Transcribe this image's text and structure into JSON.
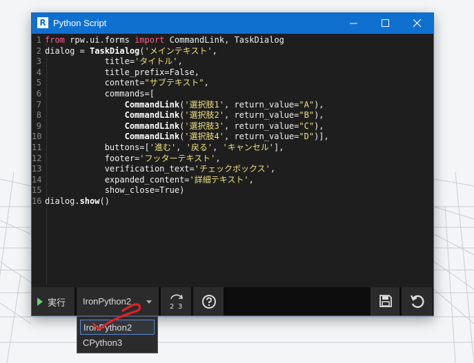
{
  "window": {
    "title": "Python Script",
    "app_icon": "R"
  },
  "editor": {
    "lines": [
      {
        "num": "1",
        "segs": [
          [
            "kw",
            "from"
          ],
          [
            "t",
            " rpw.ui.forms "
          ],
          [
            "kw",
            "import"
          ],
          [
            "t",
            " CommandLink, TaskDialog"
          ]
        ]
      },
      {
        "num": "2",
        "segs": [
          [
            "t",
            "dialog = "
          ],
          [
            "fn",
            "TaskDialog"
          ],
          [
            "t",
            "("
          ],
          [
            "st",
            "'メインテキスト'"
          ],
          [
            "t",
            ","
          ]
        ]
      },
      {
        "num": "3",
        "segs": [
          [
            "t",
            "            title="
          ],
          [
            "st",
            "'タイトル'"
          ],
          [
            "t",
            ","
          ]
        ]
      },
      {
        "num": "4",
        "segs": [
          [
            "t",
            "            title_prefix=False,"
          ]
        ]
      },
      {
        "num": "5",
        "segs": [
          [
            "t",
            "            content="
          ],
          [
            "st",
            "\"サブテキスト\""
          ],
          [
            "t",
            ","
          ]
        ]
      },
      {
        "num": "6",
        "segs": [
          [
            "t",
            "            commands=["
          ]
        ]
      },
      {
        "num": "7",
        "segs": [
          [
            "t",
            "                "
          ],
          [
            "fn",
            "CommandLink"
          ],
          [
            "t",
            "("
          ],
          [
            "st",
            "'選択肢1'"
          ],
          [
            "t",
            ", return_value="
          ],
          [
            "st",
            "\"A\""
          ],
          [
            "t",
            "),"
          ]
        ]
      },
      {
        "num": "8",
        "segs": [
          [
            "t",
            "                "
          ],
          [
            "fn",
            "CommandLink"
          ],
          [
            "t",
            "("
          ],
          [
            "st",
            "'選択肢2'"
          ],
          [
            "t",
            ", return_value="
          ],
          [
            "st",
            "\"B\""
          ],
          [
            "t",
            "),"
          ]
        ]
      },
      {
        "num": "9",
        "segs": [
          [
            "t",
            "                "
          ],
          [
            "fn",
            "CommandLink"
          ],
          [
            "t",
            "("
          ],
          [
            "st",
            "'選択肢3'"
          ],
          [
            "t",
            ", return_value="
          ],
          [
            "st",
            "\"C\""
          ],
          [
            "t",
            "),"
          ]
        ]
      },
      {
        "num": "10",
        "segs": [
          [
            "t",
            "                "
          ],
          [
            "fn",
            "CommandLink"
          ],
          [
            "t",
            "("
          ],
          [
            "st",
            "'選択肢4'"
          ],
          [
            "t",
            ", return_value="
          ],
          [
            "st",
            "\"D\""
          ],
          [
            "t",
            ")],"
          ]
        ]
      },
      {
        "num": "11",
        "segs": [
          [
            "t",
            "            buttons=["
          ],
          [
            "st",
            "'進む'"
          ],
          [
            "t",
            ", "
          ],
          [
            "st",
            "'戻る'"
          ],
          [
            "t",
            ", "
          ],
          [
            "st",
            "'キャンセル'"
          ],
          [
            "t",
            "],"
          ]
        ]
      },
      {
        "num": "12",
        "segs": [
          [
            "t",
            "            footer="
          ],
          [
            "st",
            "'フッターテキスト'"
          ],
          [
            "t",
            ","
          ]
        ]
      },
      {
        "num": "13",
        "segs": [
          [
            "t",
            "            verification_text="
          ],
          [
            "st",
            "'チェックボックス'"
          ],
          [
            "t",
            ","
          ]
        ]
      },
      {
        "num": "14",
        "segs": [
          [
            "t",
            "            expanded_content="
          ],
          [
            "st",
            "'詳細テキスト'"
          ],
          [
            "t",
            ","
          ]
        ]
      },
      {
        "num": "15",
        "segs": [
          [
            "t",
            "            show_close=True)"
          ]
        ]
      },
      {
        "num": "16",
        "segs": [
          [
            "t",
            "dialog."
          ],
          [
            "fn",
            "show"
          ],
          [
            "t",
            "()"
          ]
        ]
      }
    ]
  },
  "toolbar": {
    "run_label": "実行",
    "engine_selected": "IronPython2",
    "icons": [
      "play-icon",
      "refresh-icon",
      "help-icon",
      "save-icon",
      "undo-icon"
    ]
  },
  "engine_dropdown": {
    "options": [
      "IronPython2",
      "CPython3"
    ]
  },
  "colors": {
    "accent": "#1070cf",
    "keyword": "#ff5e88",
    "string": "#f0e080",
    "run_arrow": "#6ad06a",
    "annotation": "#e0202a"
  }
}
